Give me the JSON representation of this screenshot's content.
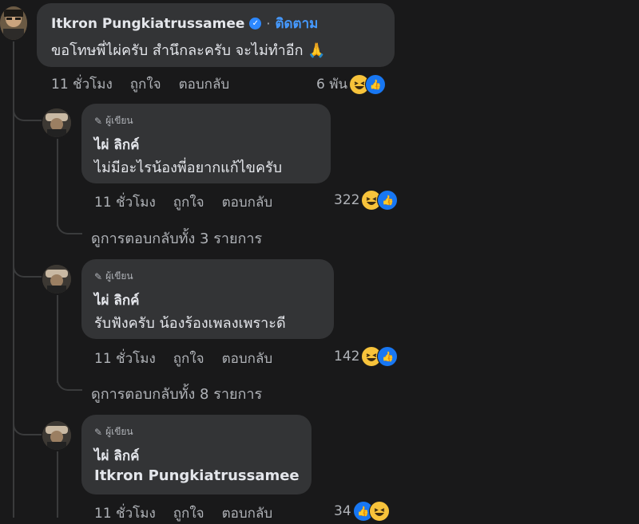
{
  "main_comment": {
    "author": "Itkron Pungkiatrussamee",
    "separator": "·",
    "follow_label": "ติดตาม",
    "text": "ขอโทษพี่ไผ่ครับ สำนึกละครับ จะไม่ทำอีก",
    "prayer_emoji": "🙏",
    "time": "11 ชั่วโมง",
    "like_label": "ถูกใจ",
    "reply_label": "ตอบกลับ",
    "reaction_count": "6 พัน"
  },
  "replies": [
    {
      "badge": "ผู้เขียน",
      "author": "ไผ่ ลิกค์",
      "text": "ไม่มีอะไรน้องพี่อยากแก้ไขครับ",
      "time": "11 ชั่วโมง",
      "like_label": "ถูกใจ",
      "reply_label": "ตอบกลับ",
      "reaction_count": "322",
      "view_more": "ดูการตอบกลับทั้ง 3 รายการ"
    },
    {
      "badge": "ผู้เขียน",
      "author": "ไผ่ ลิกค์",
      "text": "รับฟังครับ น้องร้องเพลงเพราะดี",
      "time": "11 ชั่วโมง",
      "like_label": "ถูกใจ",
      "reply_label": "ตอบกลับ",
      "reaction_count": "142",
      "view_more": "ดูการตอบกลับทั้ง 8 รายการ"
    },
    {
      "badge": "ผู้เขียน",
      "author": "ไผ่ ลิกค์",
      "text": "Itkron Pungkiatrussamee",
      "time": "11 ชั่วโมง",
      "like_label": "ถูกใจ",
      "reply_label": "ตอบกลับ",
      "reaction_count": "34"
    }
  ],
  "icons": {
    "verified": "verified-badge-icon",
    "pencil": "pencil-icon",
    "haha": "haha-reaction-icon",
    "like": "like-reaction-icon"
  },
  "colors": {
    "background": "#19191a",
    "bubble": "#333436",
    "link": "#4599ff",
    "like_blue": "#1877f2",
    "haha_yellow": "#f7c33b"
  }
}
